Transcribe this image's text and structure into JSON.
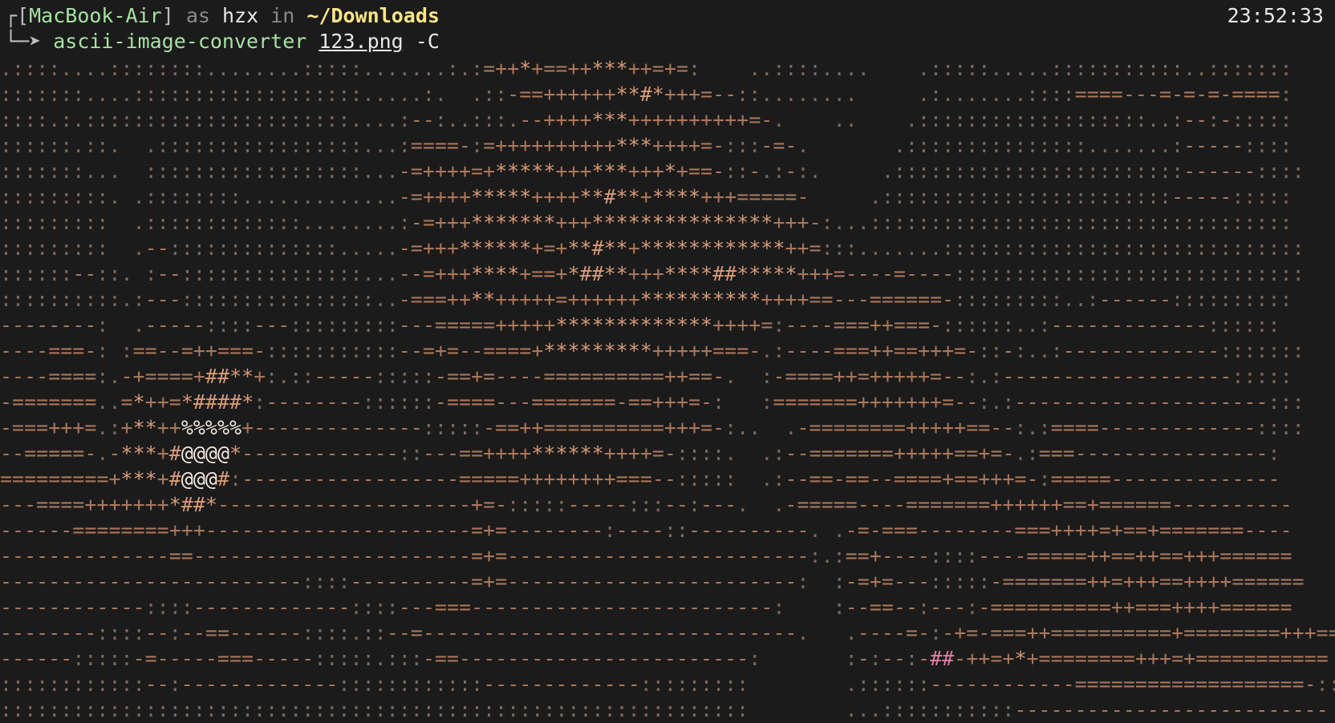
{
  "terminal": {
    "host": "MacBook-Air",
    "as_word": "as",
    "user": "hzx",
    "in_word": "in",
    "cwd": "~/Downloads",
    "command": "ascii-image-converter",
    "argument": "123.png",
    "flag": "-C",
    "clock": "23:52:33",
    "prompt_corner": "┌",
    "prompt_arrow": "└─➤ ",
    "bracket_open": "[",
    "bracket_close": "]"
  },
  "ascii_art": {
    "rows": [
      ".::::....::::::::........:::::.......:.:=++*+==++***++=+=:    ..::::....    .:::::.....:::::::::::..:::::::",
      ":::::::....:::::::::::::::::::.....:.  .::-==++++++**#*+++=--::........     .:.......::::====---=-=-=-====:",
      "::::.:.::::::::::::::::::::::....:--:..:::.--++++***++++++++++=-.    ..    .:::::::::::::::::::..:--:-:::::",
      "::::::.::.  .:::::::::::::::::...:====-:=++++++++++***++++=-:::-=-.       .:::::::::::::::.......:-----::::",
      ":::::::...  ::::::::::::::::::...-=++++=+*****+++***+++*+==-::-.:-:.     .::::::::::::::::::::::::------::::",
      ":::::::::. .::::::::.............-=++++*****++++**#**+****+++=====-     .::::::::::::::::::::::::-----:::::",
      ":::::::::  .:::::::::::::........:-=+++*******+++***************+++-:...:::::::::::::::::::::::::::::::::::",
      ":::::::::  .--::::::::::::::.....-=+++******+=+**#**+************++=:::.......::::::::::::::::::::::::::::::",
      "::::::--::. :--:::::::::::::::...--=+++****+==+*##**+++****##*****+++=----=----:::::::::::::::::::::::::::::",
      "::::::::::.:---::::::::::::::::..-===++**+++++=++++++**********++++==---======-:::::::::..:------::::::::::",
      "--------:  .-----::::---:::::::::---=====+++++*************++++=:----===++===-::::::..:-------------::::::",
      "----===-: :==--=++===-:::::::::::--=+=--====+*********+++++===-.:----===++==+++=-::-:..:-------------:::::::",
      "----====:.-+====+##**+:.::-----:::::-==+=----==========++==-.  :-====++=+++++=--:.:-------------------:::::",
      "-=======..=*++=*####*:--------::::::-====---=======-==+++=-:   :=======+++++++=--:.:---------------------:::",
      "-===+++=.:+**++%%%%%+--------------:::::-==++==========+++=-:..  .-========+++++==--:.:====-------------::::",
      "--=====-.-***+#@@@@*-------------::---==++++******++++=-::::.  .:--=======+++++==+=-.:===----------------:",
      "=========+***+#@@@#:------------------=====++++++++===--:::::  .:--==-==--====+==+++=-:=====--------------",
      "---====+++++++*##*---------------------+=-:::::-----:::--:---.  .-=====----=======++++++==+======----------",
      "------========+++----------------------=+=--------:----::----------. .-=-===--------===++++=+==+=======----",
      "--------------==-----------------------=+=-------------------------:.:==+----::::----=====++==++==+++======",
      "-------------------------::::----------=+=------------------------:  :-=+=---:::::-=======++=+++==++++======",
      "------------::::-------------::::---===-------------------------:    :--==--:---:-==========++===++++======",
      "--------::::--:--==------::::.::--=-------------------------------.   .----=-:-+=-===++==========+========+++=====",
      "------:::::-=-----===-----:::::.:::-==------------------------:       :-:--:-##-++=+*+========+++=+===========",
      "::::::::::::--:-------------::::::::::::-------------:::::::::        .::::::------------===================-::::::",
      "::::::::::::::::::::::::::::::::::::::::::::::::::::::::::::::        ...:::::::::::--------------------------"
    ]
  },
  "palette": {
    "background": "#1b1b1b",
    "art_base": "#a9765a",
    "art_light": "#d89a78",
    "art_pink": "#e37fa6",
    "art_white": "#f2e6dc",
    "art_dim": "#7a6a60"
  }
}
